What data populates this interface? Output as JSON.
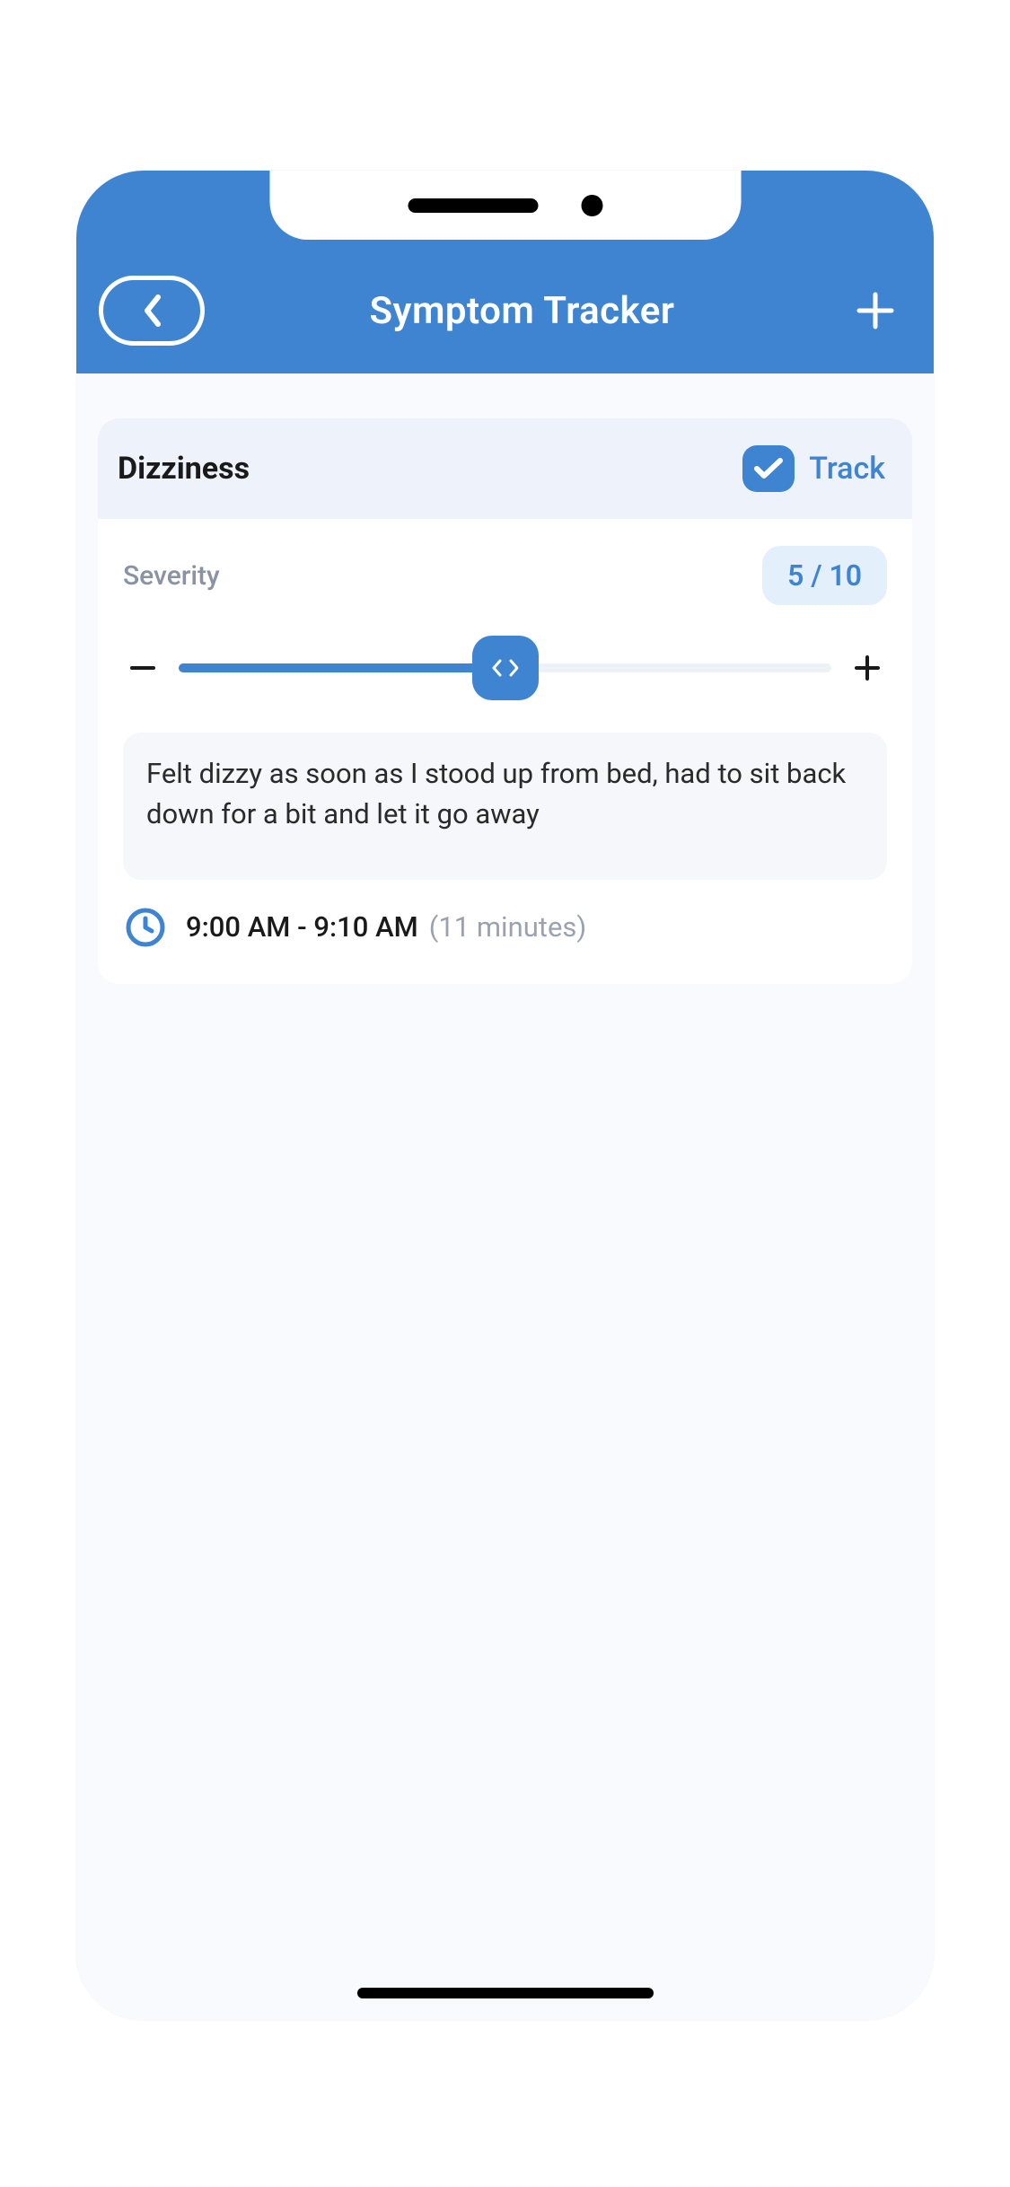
{
  "header": {
    "title": "Symptom Tracker"
  },
  "symptom": {
    "name": "Dizziness",
    "track_label": "Track",
    "tracked": true,
    "severity_label": "Severity",
    "severity_value": "5 / 10",
    "severity_fraction": 0.5,
    "notes": "Felt dizzy as soon as I stood up from bed, had to sit back down for a bit and let it go away",
    "time_range": "9:00 AM - 9:10 AM",
    "duration": "(11 minutes)"
  }
}
